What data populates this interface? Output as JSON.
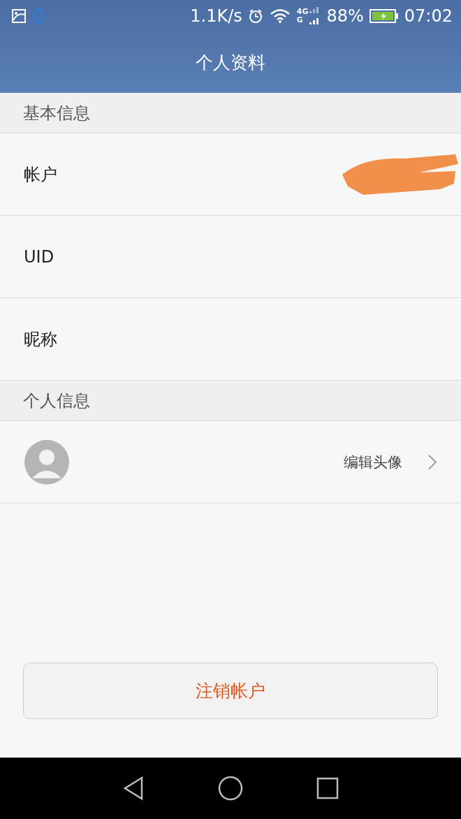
{
  "status_bar": {
    "speed": "1.1K/s",
    "network_top": "4G",
    "network_bottom": "G",
    "battery": "88%",
    "time": "07:02"
  },
  "header": {
    "title": "个人资料"
  },
  "sections": [
    {
      "title": "基本信息",
      "rows": [
        {
          "kind": "redacted",
          "label": "帐户"
        },
        {
          "kind": "text",
          "label": "UID"
        },
        {
          "kind": "text",
          "label": "昵称"
        }
      ]
    },
    {
      "title": "个人信息",
      "rows": [
        {
          "kind": "avatar",
          "action": "编辑头像"
        }
      ]
    }
  ],
  "logout_button": "注销帐户"
}
